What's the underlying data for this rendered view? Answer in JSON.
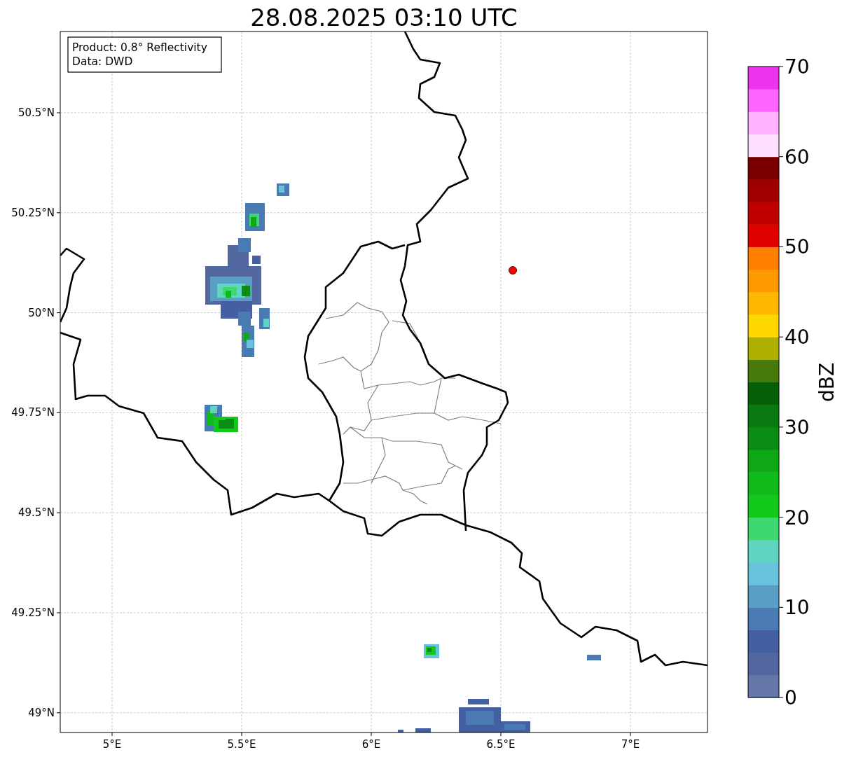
{
  "title": "28.08.2025 03:10 UTC",
  "legend": [
    "Product: 0.8° Reflectivity",
    "Data: DWD"
  ],
  "x_ticks": [
    {
      "label": "5°E"
    },
    {
      "label": "5.5°E"
    },
    {
      "label": "6°E"
    },
    {
      "label": "6.5°E"
    },
    {
      "label": "7°E"
    }
  ],
  "y_ticks": [
    {
      "label": "50.5°N"
    },
    {
      "label": "50.25°N"
    },
    {
      "label": "50°N"
    },
    {
      "label": "49.75°N"
    },
    {
      "label": "49.5°N"
    },
    {
      "label": "49.25°N"
    },
    {
      "label": "49°N"
    }
  ],
  "colorbar": {
    "label": "dBZ",
    "ticks": [
      {
        "label": "70"
      },
      {
        "label": "60"
      },
      {
        "label": "50"
      },
      {
        "label": "40"
      },
      {
        "label": "30"
      },
      {
        "label": "20"
      },
      {
        "label": "10"
      },
      {
        "label": "0"
      }
    ],
    "segments": [
      {
        "color": "#6577a8"
      },
      {
        "color": "#5367a0"
      },
      {
        "color": "#4460a3"
      },
      {
        "color": "#4a7ab2"
      },
      {
        "color": "#5a9ec6"
      },
      {
        "color": "#68c2db"
      },
      {
        "color": "#60d6c2"
      },
      {
        "color": "#3fd870"
      },
      {
        "color": "#10c918"
      },
      {
        "color": "#0fba1a"
      },
      {
        "color": "#0ea814"
      },
      {
        "color": "#0b8c14"
      },
      {
        "color": "#0a7a10"
      },
      {
        "color": "#075f0a"
      },
      {
        "color": "#477a0b"
      },
      {
        "color": "#b0b000"
      },
      {
        "color": "#ffd700"
      },
      {
        "color": "#ffb700"
      },
      {
        "color": "#ff9900"
      },
      {
        "color": "#ff7f00"
      },
      {
        "color": "#e00000"
      },
      {
        "color": "#c00000"
      },
      {
        "color": "#a00000"
      },
      {
        "color": "#7a0000"
      },
      {
        "color": "#ffdfff"
      },
      {
        "color": "#ffb3ff"
      },
      {
        "color": "#ff66ff"
      },
      {
        "color": "#ee33ee"
      }
    ]
  }
}
